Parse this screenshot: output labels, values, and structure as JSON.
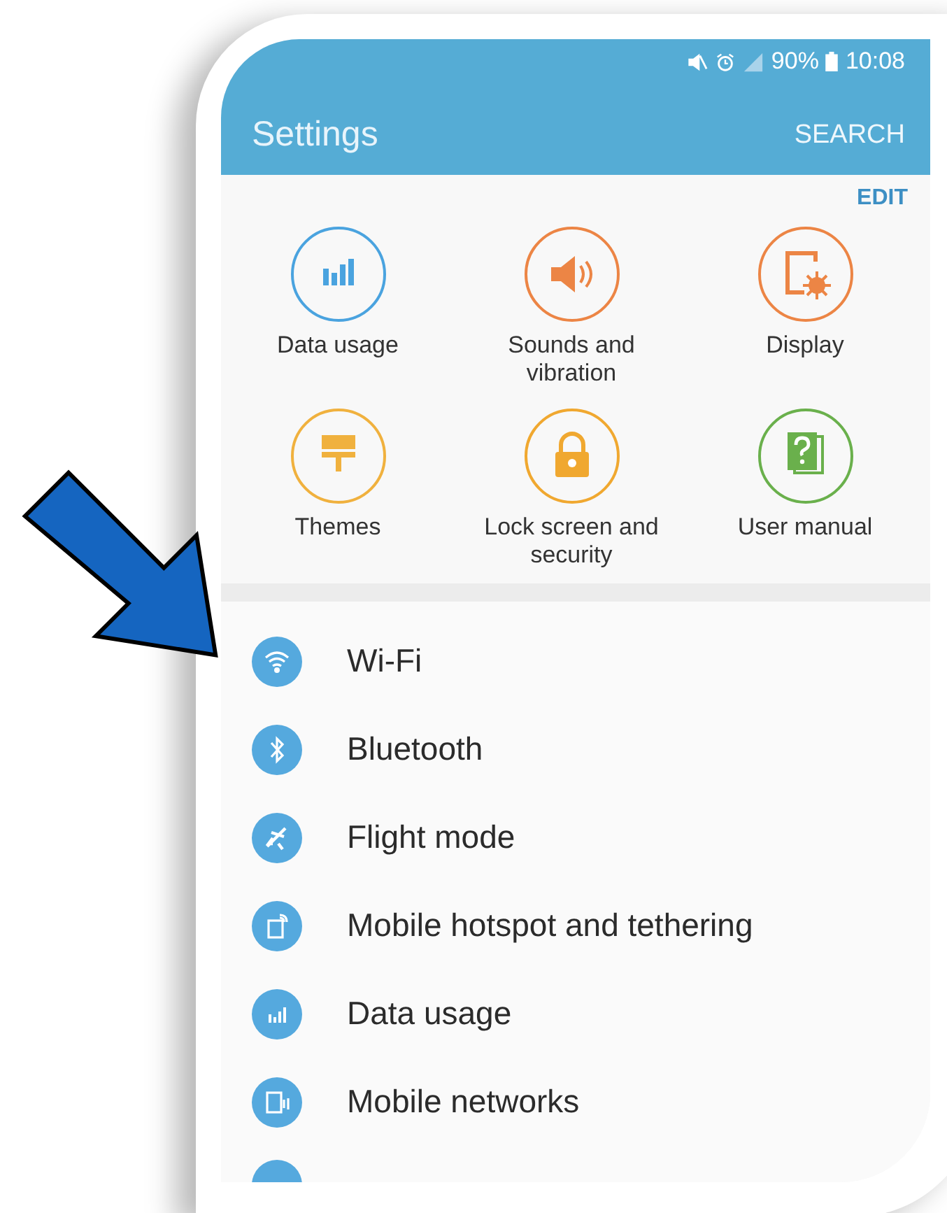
{
  "status_bar": {
    "battery": "90%",
    "time": "10:08"
  },
  "header": {
    "title": "Settings",
    "action": "SEARCH"
  },
  "quick_settings": {
    "edit": "EDIT",
    "items": [
      {
        "label": "Data usage",
        "color": "#4aa3df"
      },
      {
        "label": "Sounds and vibration",
        "color": "#ec8545"
      },
      {
        "label": "Display",
        "color": "#ec8545"
      },
      {
        "label": "Themes",
        "color": "#f0b13e"
      },
      {
        "label": "Lock screen and security",
        "color": "#f0a830"
      },
      {
        "label": "User manual",
        "color": "#6ab04c"
      }
    ]
  },
  "list": [
    {
      "label": "Wi-Fi"
    },
    {
      "label": "Bluetooth"
    },
    {
      "label": "Flight mode"
    },
    {
      "label": "Mobile hotspot and tethering"
    },
    {
      "label": "Data usage"
    },
    {
      "label": "Mobile networks"
    }
  ]
}
